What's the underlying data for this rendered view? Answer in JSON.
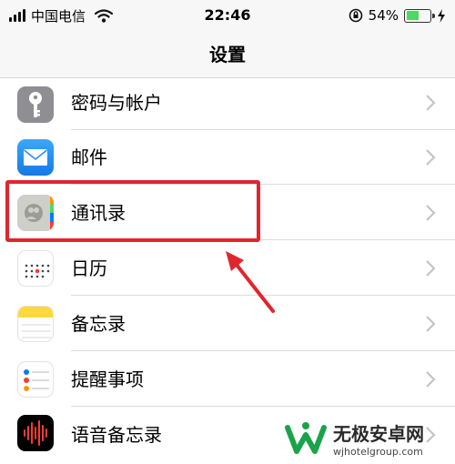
{
  "status_bar": {
    "carrier": "中国电信",
    "time": "22:46",
    "battery_text": "54%",
    "battery_level": 0.54,
    "icons": [
      "signal-icon",
      "wifi-icon",
      "orientation-lock-icon",
      "battery-icon",
      "charging-icon"
    ]
  },
  "nav": {
    "title": "设置"
  },
  "list": {
    "items": [
      {
        "label": "密码与帐户",
        "icon": "key-icon",
        "icon_color": "#8e8e93"
      },
      {
        "label": "邮件",
        "icon": "mail-icon",
        "icon_color": "#1f8ef1"
      },
      {
        "label": "通讯录",
        "icon": "contacts-icon",
        "icon_color": "#c9c9c4"
      },
      {
        "label": "日历",
        "icon": "calendar-icon",
        "icon_color": "#ffffff"
      },
      {
        "label": "备忘录",
        "icon": "notes-icon",
        "icon_color": "#ffd83b"
      },
      {
        "label": "提醒事项",
        "icon": "reminders-icon",
        "icon_color": "#ffffff"
      },
      {
        "label": "语音备忘录",
        "icon": "voice-memos-icon",
        "icon_color": "#000000"
      }
    ]
  },
  "annotation": {
    "highlight_color": "#e0262d",
    "highlighted_item": "通讯录"
  },
  "watermark": {
    "name": "无极安卓网",
    "url": "wjhotelgroup.com"
  }
}
